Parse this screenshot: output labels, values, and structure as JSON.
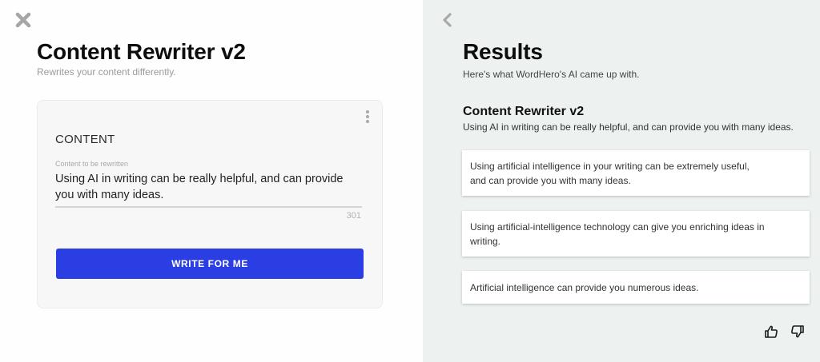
{
  "left": {
    "title": "Content Rewriter v2",
    "subtitle": "Rewrites your content differently.",
    "card": {
      "section_label": "CONTENT",
      "field_label": "Content to be rewritten",
      "field_value": "Using AI in writing can be really helpful, and can provide you with many ideas.",
      "char_count": "301",
      "button_label": "WRITE FOR ME"
    }
  },
  "right": {
    "title": "Results",
    "subtitle": "Here's what WordHero's AI came up with.",
    "result_heading": "Content Rewriter v2",
    "result_prompt": "Using AI in writing can be really helpful, and can provide you with many ideas.",
    "results": [
      "Using artificial intelligence in your writing can be extremely useful, and can provide you with many ideas.",
      "Using artificial-intelligence technology can give you enriching ideas in writing.",
      "Artificial intelligence can provide you numerous ideas."
    ]
  },
  "icons": {
    "close": "close-icon",
    "back": "chevron-left-icon",
    "menu": "kebab-menu-icon",
    "like": "thumbs-up-icon",
    "dislike": "thumbs-down-icon"
  },
  "colors": {
    "accent": "#2b3ee3",
    "results_background": "#edf2f0",
    "muted_text": "#a8a8a8"
  }
}
